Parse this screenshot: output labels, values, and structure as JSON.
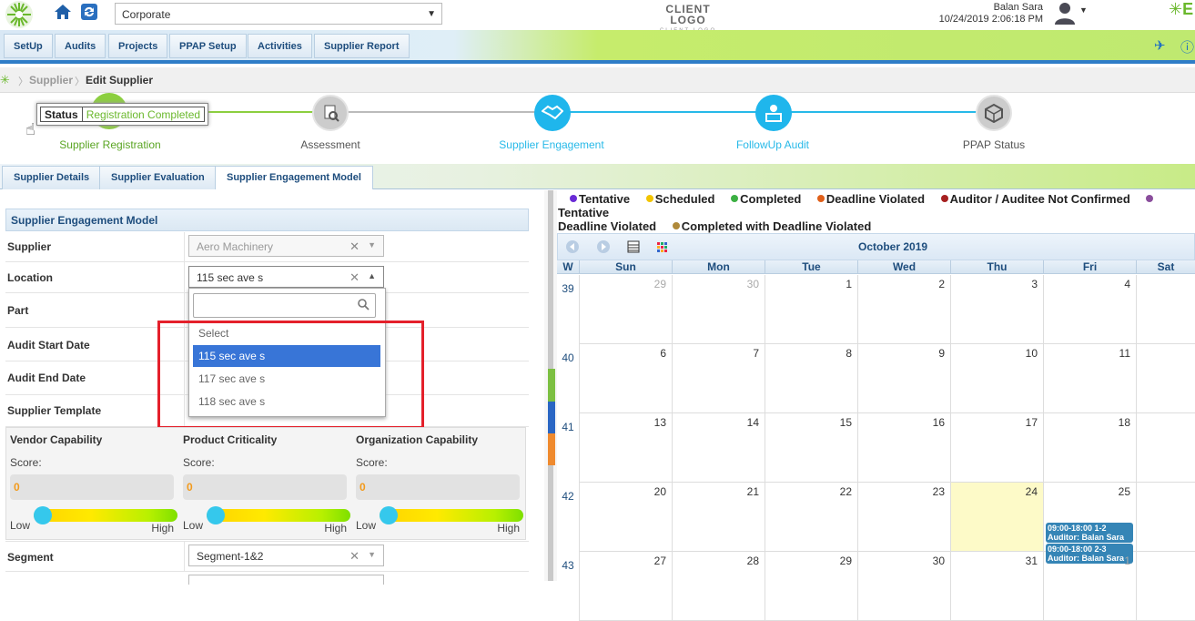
{
  "header": {
    "company": "Corporate",
    "client_logo": "CLIENT LOGO",
    "client_logo_sub": "CLIENT LOGO",
    "user_name": "Balan Sara",
    "datetime": "10/24/2019 2:06:18 PM",
    "brand_fragment": "E"
  },
  "nav": {
    "items": [
      "SetUp",
      "Audits",
      "Projects",
      "PPAP Setup",
      "Activities",
      "Supplier Report"
    ]
  },
  "breadcrumb": {
    "parent": "Supplier",
    "current": "Edit Supplier"
  },
  "stepper": {
    "status_key": "Status",
    "status_value": "Registration Completed",
    "steps": [
      "Supplier Registration",
      "Assessment",
      "Supplier Engagement",
      "FollowUp Audit",
      "PPAP Status"
    ]
  },
  "tabs": [
    "Supplier Details",
    "Supplier Evaluation",
    "Supplier Engagement Model"
  ],
  "form": {
    "title": "Supplier Engagement Model",
    "supplier_label": "Supplier",
    "supplier_value": "Aero Machinery",
    "location_label": "Location",
    "location_value": "115 sec ave s",
    "part_label": "Part",
    "audit_start_label": "Audit Start Date",
    "audit_end_label": "Audit End Date",
    "template_label": "Supplier Template",
    "segment_label": "Segment",
    "segment_value": "Segment-1&2",
    "dropdown_options": [
      "Select",
      "115 sec ave s",
      "117 sec ave s",
      "118 sec ave s"
    ],
    "dropdown_search": ""
  },
  "capabilities": [
    {
      "title": "Vendor Capability",
      "score_label": "Score:",
      "score": "0",
      "low": "Low",
      "high": "High",
      "level": 0
    },
    {
      "title": "Product Criticality",
      "score_label": "Score:",
      "score": "0",
      "low": "Low",
      "high": "High",
      "level": 0
    },
    {
      "title": "Organization Capability",
      "score_label": "Score:",
      "score": "0",
      "low": "Low",
      "high": "High",
      "level": 0
    }
  ],
  "calendar": {
    "legend": [
      {
        "label": "Tentative",
        "color": "#6a2bd6"
      },
      {
        "label": "Scheduled",
        "color": "#f2c400"
      },
      {
        "label": "Completed",
        "color": "#3cb043"
      },
      {
        "label": "Deadline Violated",
        "color": "#e0601a"
      },
      {
        "label": "Auditor / Auditee Not Confirmed",
        "color": "#a62020"
      },
      {
        "label": "Tentative",
        "color": "#8a4e9c"
      }
    ],
    "legend_line2": "Deadline Violated",
    "legend_extra": {
      "label": "Completed with Deadline Violated",
      "color": "#b08a3a"
    },
    "month_title": "October 2019",
    "week_header": "W",
    "days": [
      "Sun",
      "Mon",
      "Tue",
      "Wed",
      "Thu",
      "Fri",
      "Sat"
    ],
    "weeks": [
      {
        "wk": "39",
        "dates": [
          "29",
          "30",
          "1",
          "2",
          "3",
          "4",
          ""
        ],
        "other": [
          true,
          true,
          false,
          false,
          false,
          false,
          false
        ]
      },
      {
        "wk": "40",
        "dates": [
          "6",
          "7",
          "8",
          "9",
          "10",
          "11",
          ""
        ],
        "other": [
          false,
          false,
          false,
          false,
          false,
          false,
          false
        ]
      },
      {
        "wk": "41",
        "dates": [
          "13",
          "14",
          "15",
          "16",
          "17",
          "18",
          ""
        ],
        "other": [
          false,
          false,
          false,
          false,
          false,
          false,
          false
        ]
      },
      {
        "wk": "42",
        "dates": [
          "20",
          "21",
          "22",
          "23",
          "24",
          "25",
          ""
        ],
        "other": [
          false,
          false,
          false,
          false,
          false,
          false,
          false
        ]
      },
      {
        "wk": "43",
        "dates": [
          "27",
          "28",
          "29",
          "30",
          "31",
          "1",
          ""
        ],
        "other": [
          false,
          false,
          false,
          false,
          false,
          true,
          false
        ]
      }
    ],
    "events": [
      {
        "time": "09:00-18:00 1-2",
        "auditor": "Auditor: Balan Sara"
      },
      {
        "time": "09:00-18:00 2-3",
        "auditor": "Auditor: Balan Sara"
      }
    ]
  }
}
